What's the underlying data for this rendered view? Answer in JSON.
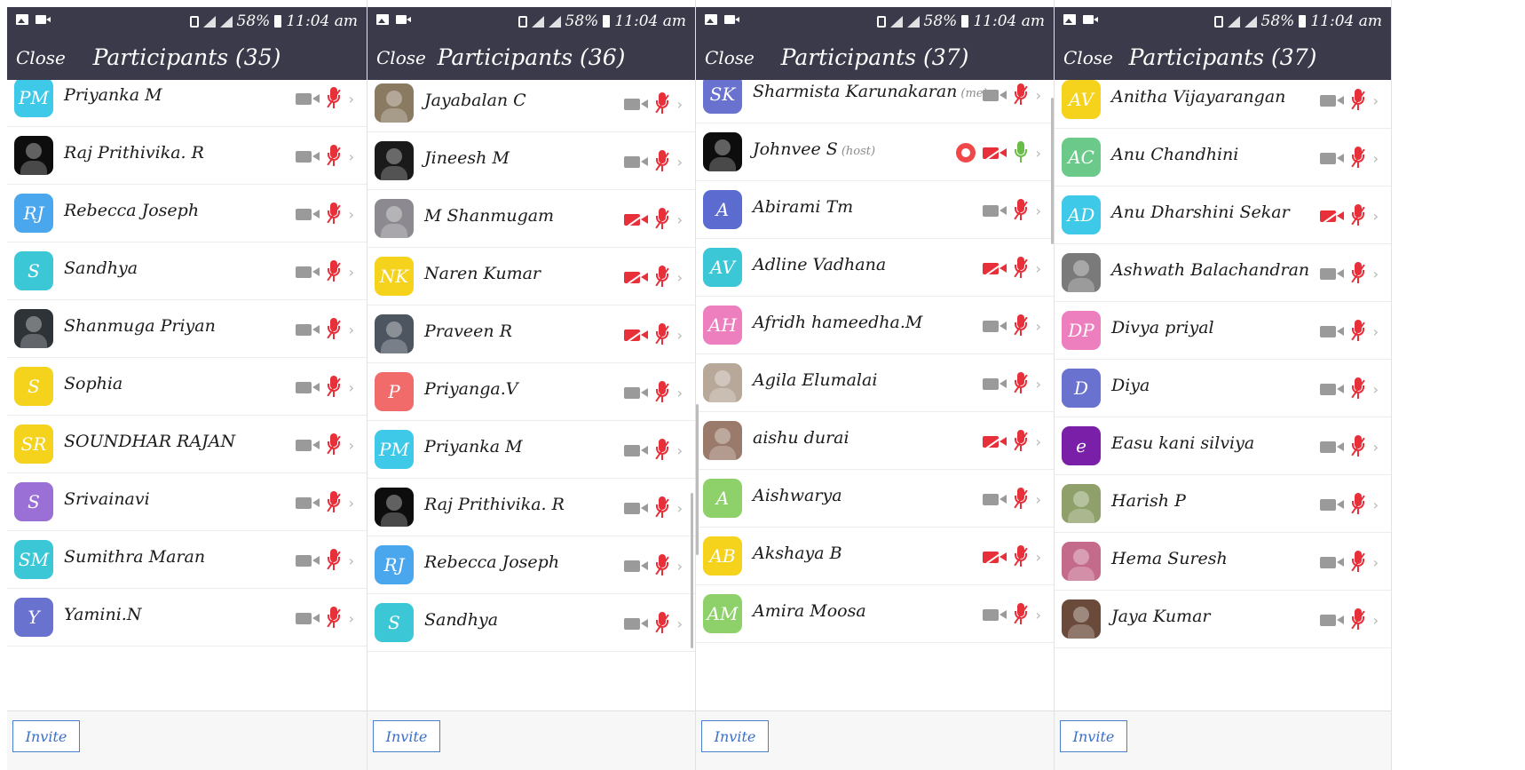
{
  "colors": {
    "header": "#3b3a4a",
    "muted_red": "#e8303a",
    "live_green": "#6bbd4a",
    "invite_blue": "#3a6fc8"
  },
  "status": {
    "signal_text": "58%",
    "time": "11:04 am"
  },
  "close_label": "Close",
  "invite_label": "Invite",
  "panels": [
    {
      "title": "Participants (35)",
      "participants": [
        {
          "initials": "PM",
          "name": "Priyanka M",
          "color": "#3ec9e8",
          "video": "on",
          "audio": "muted"
        },
        {
          "initials": "",
          "name": "Raj Prithivika. R",
          "color": "#0d0d0d",
          "photo": true,
          "video": "on",
          "audio": "muted"
        },
        {
          "initials": "RJ",
          "name": "Rebecca Joseph",
          "color": "#4aa7ee",
          "video": "on",
          "audio": "muted"
        },
        {
          "initials": "S",
          "name": "Sandhya",
          "color": "#3cc7d6",
          "video": "on",
          "audio": "muted"
        },
        {
          "initials": "",
          "name": "Shanmuga Priyan",
          "color": "#2e3338",
          "photo": true,
          "video": "on",
          "audio": "muted"
        },
        {
          "initials": "S",
          "name": "Sophia",
          "color": "#f5d21c",
          "video": "on",
          "audio": "muted"
        },
        {
          "initials": "SR",
          "name": "SOUNDHAR RAJAN",
          "color": "#f5d21c",
          "video": "on",
          "audio": "muted"
        },
        {
          "initials": "S",
          "name": "Srivainavi",
          "color": "#9a6fd6",
          "video": "on",
          "audio": "muted"
        },
        {
          "initials": "SM",
          "name": "Sumithra Maran",
          "color": "#3cc7d6",
          "video": "on",
          "audio": "muted"
        },
        {
          "initials": "Y",
          "name": "Yamini.N",
          "color": "#6a72cf",
          "video": "on",
          "audio": "muted"
        }
      ]
    },
    {
      "title": "Participants (36)",
      "participants": [
        {
          "initials": "",
          "name": "Jayabalan C",
          "color": "#8a7a62",
          "photo": true,
          "video": "on",
          "audio": "muted"
        },
        {
          "initials": "",
          "name": "Jineesh M",
          "color": "#1a1a1a",
          "photo": true,
          "video": "on",
          "audio": "muted"
        },
        {
          "initials": "",
          "name": "M Shanmugam",
          "color": "#8c8a90",
          "photo": true,
          "video": "off",
          "audio": "muted"
        },
        {
          "initials": "NK",
          "name": "Naren Kumar",
          "color": "#f5d21c",
          "video": "off",
          "audio": "muted"
        },
        {
          "initials": "",
          "name": "Praveen R",
          "color": "#4d5560",
          "photo": true,
          "video": "off",
          "audio": "muted"
        },
        {
          "initials": "P",
          "name": "Priyanga.V",
          "color": "#f26b6b",
          "video": "on",
          "audio": "muted"
        },
        {
          "initials": "PM",
          "name": "Priyanka M",
          "color": "#3ec9e8",
          "video": "on",
          "audio": "muted"
        },
        {
          "initials": "",
          "name": "Raj Prithivika. R",
          "color": "#0d0d0d",
          "photo": true,
          "video": "on",
          "audio": "muted"
        },
        {
          "initials": "RJ",
          "name": "Rebecca Joseph",
          "color": "#4aa7ee",
          "video": "on",
          "audio": "muted"
        },
        {
          "initials": "S",
          "name": "Sandhya",
          "color": "#3cc7d6",
          "video": "on",
          "audio": "muted"
        }
      ]
    },
    {
      "title": "Participants (37)",
      "participants": [
        {
          "initials": "SK",
          "name": "Sharmista Karunakaran",
          "tag": "(me)",
          "color": "#6a72cf",
          "video": "on",
          "audio": "muted"
        },
        {
          "initials": "",
          "name": "Johnvee S",
          "tag": "(host)",
          "color": "#0d0d0d",
          "photo": true,
          "video": "off",
          "audio": "live",
          "recording": true
        },
        {
          "initials": "A",
          "name": "Abirami Tm",
          "color": "#5b6bd0",
          "video": "on",
          "audio": "muted"
        },
        {
          "initials": "AV",
          "name": "Adline Vadhana",
          "color": "#3cc7d6",
          "video": "off",
          "audio": "muted"
        },
        {
          "initials": "AH",
          "name": "Afridh hameedha.M",
          "color": "#ee7fbf",
          "video": "on",
          "audio": "muted"
        },
        {
          "initials": "",
          "name": "Agila Elumalai",
          "color": "#b8a89a",
          "photo": true,
          "video": "on",
          "audio": "muted"
        },
        {
          "initials": "",
          "name": "aishu durai",
          "color": "#9a7a6a",
          "photo": true,
          "video": "off",
          "audio": "muted"
        },
        {
          "initials": "A",
          "name": "Aishwarya",
          "color": "#8ed16a",
          "video": "on",
          "audio": "muted"
        },
        {
          "initials": "AB",
          "name": "Akshaya B",
          "color": "#f5d21c",
          "video": "off",
          "audio": "muted"
        },
        {
          "initials": "AM",
          "name": "Amira Moosa",
          "color": "#8ed16a",
          "video": "on",
          "audio": "muted"
        }
      ]
    },
    {
      "title": "Participants (37)",
      "participants": [
        {
          "initials": "AV",
          "name": "Anitha Vijayarangan",
          "color": "#f5d21c",
          "video": "on",
          "audio": "muted"
        },
        {
          "initials": "AC",
          "name": "Anu Chandhini",
          "color": "#6bc98a",
          "video": "on",
          "audio": "muted"
        },
        {
          "initials": "AD",
          "name": "Anu Dharshini Sekar",
          "color": "#3ec9e8",
          "video": "off",
          "audio": "muted"
        },
        {
          "initials": "",
          "name": "Ashwath Balachandran",
          "color": "#7a7a7a",
          "photo": true,
          "video": "on",
          "audio": "muted"
        },
        {
          "initials": "DP",
          "name": "Divya priyal",
          "color": "#ee7fbf",
          "video": "on",
          "audio": "muted"
        },
        {
          "initials": "D",
          "name": "Diya",
          "color": "#6a72cf",
          "video": "on",
          "audio": "muted"
        },
        {
          "initials": "e",
          "name": "Easu kani silviya",
          "color": "#7a1fa8",
          "video": "on",
          "audio": "muted"
        },
        {
          "initials": "",
          "name": "Harish P",
          "color": "#8fa06a",
          "photo": true,
          "video": "on",
          "audio": "muted"
        },
        {
          "initials": "",
          "name": "Hema Suresh",
          "color": "#c46a8a",
          "photo": true,
          "video": "on",
          "audio": "muted"
        },
        {
          "initials": "",
          "name": "Jaya Kumar",
          "color": "#6a4a3a",
          "photo": true,
          "video": "on",
          "audio": "muted"
        }
      ]
    }
  ]
}
